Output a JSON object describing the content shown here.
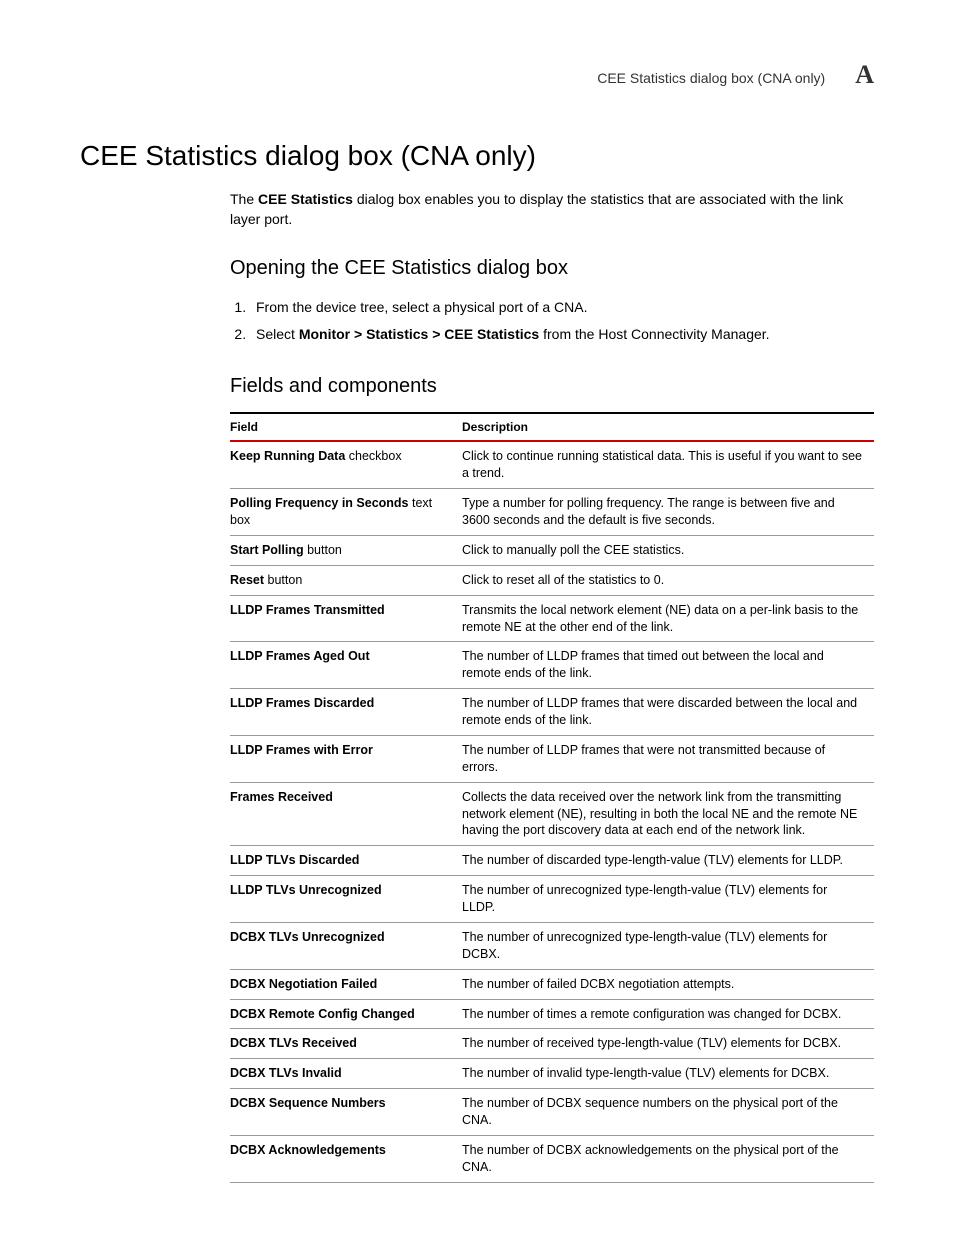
{
  "header": {
    "running_head": "CEE Statistics dialog box (CNA only)",
    "appendix": "A"
  },
  "h1": "CEE Statistics dialog box (CNA only)",
  "intro": {
    "prefix": "The ",
    "bold": "CEE Statistics",
    "suffix": " dialog box enables you to display the statistics that are associated with the link layer port."
  },
  "h2_open": "Opening the CEE Statistics dialog box",
  "steps": {
    "s1": "From the device tree, select a physical port of a CNA.",
    "s2_prefix": "Select ",
    "s2_bold": "Monitor > Statistics > CEE Statistics",
    "s2_suffix": " from the Host Connectivity Manager."
  },
  "h2_fields": "Fields and components",
  "table": {
    "col_field": "Field",
    "col_desc": "Description",
    "rows": [
      {
        "f_b": "Keep Running Data",
        "f_s": " checkbox",
        "d": "Click to continue running statistical data. This is useful if you want to see a trend."
      },
      {
        "f_b": "Polling Frequency in Seconds",
        "f_s": " text box",
        "d": "Type a number for polling frequency. The range is between five and 3600 seconds and the default is five seconds."
      },
      {
        "f_b": "Start Polling",
        "f_s": " button",
        "d": "Click to manually poll the CEE statistics."
      },
      {
        "f_b": "Reset",
        "f_s": " button",
        "d": "Click to reset all of the statistics to 0."
      },
      {
        "f_b": "LLDP Frames Transmitted",
        "f_s": "",
        "d": "Transmits the local network element (NE) data on a per-link basis to the remote NE at the other end of the link."
      },
      {
        "f_b": "LLDP Frames Aged Out",
        "f_s": "",
        "d": "The number of LLDP frames that timed out between the local and remote ends of the link."
      },
      {
        "f_b": "LLDP Frames Discarded",
        "f_s": "",
        "d": "The number of LLDP frames that were discarded between the local and remote ends of the link."
      },
      {
        "f_b": "LLDP Frames with Error",
        "f_s": "",
        "d": "The number of LLDP frames that were not transmitted because of errors."
      },
      {
        "f_b": "Frames Received",
        "f_s": "",
        "d": "Collects the data received over the network link from the transmitting network element (NE), resulting in both the local NE and the remote NE having the port discovery data at each end of the network link."
      },
      {
        "f_b": "LLDP TLVs Discarded",
        "f_s": "",
        "d": "The number of discarded type-length-value (TLV) elements for LLDP."
      },
      {
        "f_b": "LLDP TLVs Unrecognized",
        "f_s": "",
        "d": "The number of unrecognized type-length-value (TLV) elements for LLDP."
      },
      {
        "f_b": "DCBX TLVs Unrecognized",
        "f_s": "",
        "d": "The number of unrecognized type-length-value (TLV) elements for DCBX."
      },
      {
        "f_b": "DCBX Negotiation Failed",
        "f_s": "",
        "d": "The number of failed DCBX negotiation attempts."
      },
      {
        "f_b": "DCBX Remote Config Changed",
        "f_s": "",
        "d": "The number of times a remote configuration was changed for DCBX."
      },
      {
        "f_b": "DCBX TLVs Received",
        "f_s": "",
        "d": "The number of received type-length-value (TLV) elements for DCBX."
      },
      {
        "f_b": "DCBX TLVs Invalid",
        "f_s": "",
        "d": "The number of invalid type-length-value (TLV) elements for DCBX."
      },
      {
        "f_b": "DCBX Sequence Numbers",
        "f_s": "",
        "d": "The number of DCBX sequence numbers on the physical port of the CNA."
      },
      {
        "f_b": "DCBX Acknowledgements",
        "f_s": "",
        "d": "The number of DCBX acknowledgements on the physical port of the CNA."
      }
    ]
  }
}
